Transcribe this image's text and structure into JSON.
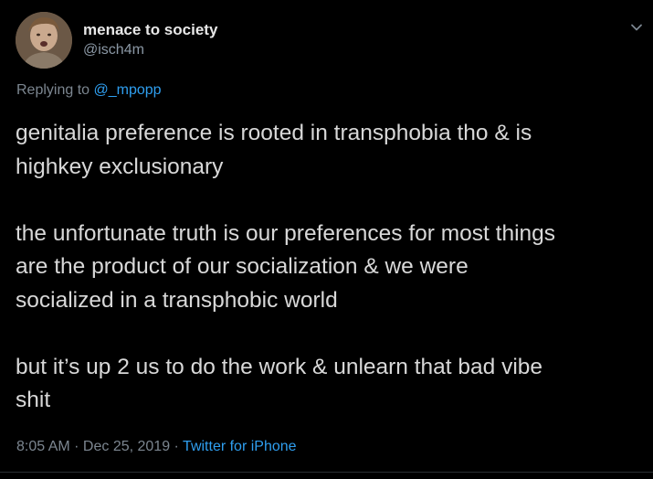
{
  "author": {
    "display_name": "menace to society",
    "handle": "@isch4m"
  },
  "reply": {
    "prefix": "Replying to ",
    "to": "@_mpopp"
  },
  "tweet": {
    "paragraphs": [
      {
        "lines": [
          "genitalia preference is rooted in transphobia tho & is",
          "highkey exclusionary"
        ]
      },
      {
        "lines": [
          "the unfortunate truth is our preferences for most things",
          "are the product of our socialization & we were",
          "socialized in a transphobic world"
        ]
      },
      {
        "lines": [
          "but it’s up 2 us to do the work & unlearn that bad vibe",
          "shit"
        ]
      }
    ]
  },
  "meta": {
    "time": "8:05 AM",
    "sep1": " · ",
    "date": "Dec 25, 2019",
    "sep2": " · ",
    "source": "Twitter for iPhone"
  },
  "icons": {
    "avatar": "avatar-photo",
    "more": "chevron-down-icon"
  },
  "colors": {
    "background": "#000000",
    "link": "#2f9ff0",
    "secondary_text": "#7c8690",
    "primary_text": "#d8d8d8"
  }
}
